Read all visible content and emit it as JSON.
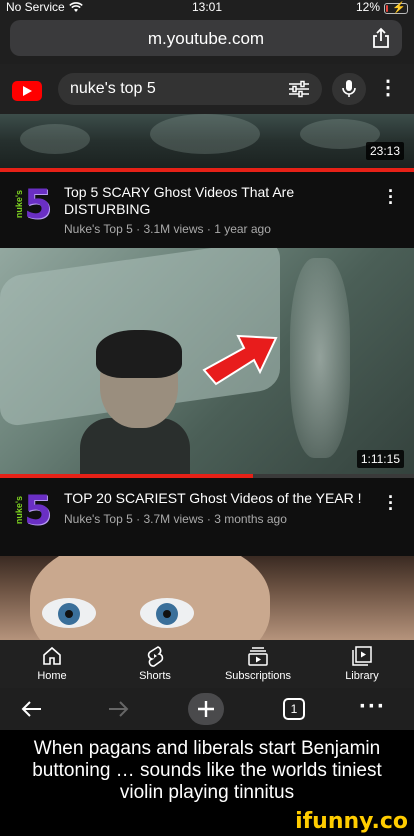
{
  "status_bar": {
    "carrier": "No Service",
    "time": "13:01",
    "battery": "12%",
    "battery_level": 0.12
  },
  "browser": {
    "url": "m.youtube.com",
    "tab_count": "1"
  },
  "youtube": {
    "search_query": "nuke's top 5",
    "colors": {
      "brand": "#ff0000",
      "progress": "#e62117"
    },
    "videos": [
      {
        "duration": "23:13",
        "title": "",
        "channel": "",
        "views": "",
        "age": "",
        "watched_fraction": 1.0
      },
      {
        "title": "Top 5 SCARY Ghost Videos That Are DISTURBING",
        "channel": "Nuke's Top 5",
        "views": "3.1M views",
        "age": "1 year ago"
      },
      {
        "duration": "1:11:15",
        "title": "TOP 20 SCARIEST Ghost Videos of the YEAR !",
        "channel": "Nuke's Top 5",
        "views": "3.7M views",
        "age": "3 months ago",
        "watched_fraction": 0.61
      }
    ],
    "channel_avatar": {
      "text": "nuke's",
      "number": "5"
    },
    "nav": [
      {
        "label": "Home",
        "icon": "home-icon"
      },
      {
        "label": "Shorts",
        "icon": "shorts-icon"
      },
      {
        "label": "Subscriptions",
        "icon": "subscriptions-icon"
      },
      {
        "label": "Library",
        "icon": "library-icon"
      }
    ]
  },
  "caption": {
    "text": "When pagans and liberals start Benjamin buttoning … sounds like the worlds tiniest violin playing tinnitus",
    "watermark": "ifunny.co"
  }
}
